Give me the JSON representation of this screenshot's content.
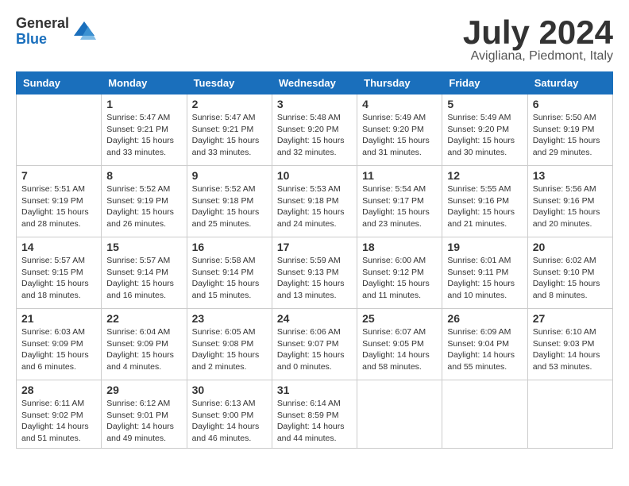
{
  "logo": {
    "general": "General",
    "blue": "Blue"
  },
  "title": "July 2024",
  "location": "Avigliana, Piedmont, Italy",
  "headers": [
    "Sunday",
    "Monday",
    "Tuesday",
    "Wednesday",
    "Thursday",
    "Friday",
    "Saturday"
  ],
  "weeks": [
    [
      {
        "day": "",
        "info": ""
      },
      {
        "day": "1",
        "info": "Sunrise: 5:47 AM\nSunset: 9:21 PM\nDaylight: 15 hours\nand 33 minutes."
      },
      {
        "day": "2",
        "info": "Sunrise: 5:47 AM\nSunset: 9:21 PM\nDaylight: 15 hours\nand 33 minutes."
      },
      {
        "day": "3",
        "info": "Sunrise: 5:48 AM\nSunset: 9:20 PM\nDaylight: 15 hours\nand 32 minutes."
      },
      {
        "day": "4",
        "info": "Sunrise: 5:49 AM\nSunset: 9:20 PM\nDaylight: 15 hours\nand 31 minutes."
      },
      {
        "day": "5",
        "info": "Sunrise: 5:49 AM\nSunset: 9:20 PM\nDaylight: 15 hours\nand 30 minutes."
      },
      {
        "day": "6",
        "info": "Sunrise: 5:50 AM\nSunset: 9:19 PM\nDaylight: 15 hours\nand 29 minutes."
      }
    ],
    [
      {
        "day": "7",
        "info": "Sunrise: 5:51 AM\nSunset: 9:19 PM\nDaylight: 15 hours\nand 28 minutes."
      },
      {
        "day": "8",
        "info": "Sunrise: 5:52 AM\nSunset: 9:19 PM\nDaylight: 15 hours\nand 26 minutes."
      },
      {
        "day": "9",
        "info": "Sunrise: 5:52 AM\nSunset: 9:18 PM\nDaylight: 15 hours\nand 25 minutes."
      },
      {
        "day": "10",
        "info": "Sunrise: 5:53 AM\nSunset: 9:18 PM\nDaylight: 15 hours\nand 24 minutes."
      },
      {
        "day": "11",
        "info": "Sunrise: 5:54 AM\nSunset: 9:17 PM\nDaylight: 15 hours\nand 23 minutes."
      },
      {
        "day": "12",
        "info": "Sunrise: 5:55 AM\nSunset: 9:16 PM\nDaylight: 15 hours\nand 21 minutes."
      },
      {
        "day": "13",
        "info": "Sunrise: 5:56 AM\nSunset: 9:16 PM\nDaylight: 15 hours\nand 20 minutes."
      }
    ],
    [
      {
        "day": "14",
        "info": "Sunrise: 5:57 AM\nSunset: 9:15 PM\nDaylight: 15 hours\nand 18 minutes."
      },
      {
        "day": "15",
        "info": "Sunrise: 5:57 AM\nSunset: 9:14 PM\nDaylight: 15 hours\nand 16 minutes."
      },
      {
        "day": "16",
        "info": "Sunrise: 5:58 AM\nSunset: 9:14 PM\nDaylight: 15 hours\nand 15 minutes."
      },
      {
        "day": "17",
        "info": "Sunrise: 5:59 AM\nSunset: 9:13 PM\nDaylight: 15 hours\nand 13 minutes."
      },
      {
        "day": "18",
        "info": "Sunrise: 6:00 AM\nSunset: 9:12 PM\nDaylight: 15 hours\nand 11 minutes."
      },
      {
        "day": "19",
        "info": "Sunrise: 6:01 AM\nSunset: 9:11 PM\nDaylight: 15 hours\nand 10 minutes."
      },
      {
        "day": "20",
        "info": "Sunrise: 6:02 AM\nSunset: 9:10 PM\nDaylight: 15 hours\nand 8 minutes."
      }
    ],
    [
      {
        "day": "21",
        "info": "Sunrise: 6:03 AM\nSunset: 9:09 PM\nDaylight: 15 hours\nand 6 minutes."
      },
      {
        "day": "22",
        "info": "Sunrise: 6:04 AM\nSunset: 9:09 PM\nDaylight: 15 hours\nand 4 minutes."
      },
      {
        "day": "23",
        "info": "Sunrise: 6:05 AM\nSunset: 9:08 PM\nDaylight: 15 hours\nand 2 minutes."
      },
      {
        "day": "24",
        "info": "Sunrise: 6:06 AM\nSunset: 9:07 PM\nDaylight: 15 hours\nand 0 minutes."
      },
      {
        "day": "25",
        "info": "Sunrise: 6:07 AM\nSunset: 9:05 PM\nDaylight: 14 hours\nand 58 minutes."
      },
      {
        "day": "26",
        "info": "Sunrise: 6:09 AM\nSunset: 9:04 PM\nDaylight: 14 hours\nand 55 minutes."
      },
      {
        "day": "27",
        "info": "Sunrise: 6:10 AM\nSunset: 9:03 PM\nDaylight: 14 hours\nand 53 minutes."
      }
    ],
    [
      {
        "day": "28",
        "info": "Sunrise: 6:11 AM\nSunset: 9:02 PM\nDaylight: 14 hours\nand 51 minutes."
      },
      {
        "day": "29",
        "info": "Sunrise: 6:12 AM\nSunset: 9:01 PM\nDaylight: 14 hours\nand 49 minutes."
      },
      {
        "day": "30",
        "info": "Sunrise: 6:13 AM\nSunset: 9:00 PM\nDaylight: 14 hours\nand 46 minutes."
      },
      {
        "day": "31",
        "info": "Sunrise: 6:14 AM\nSunset: 8:59 PM\nDaylight: 14 hours\nand 44 minutes."
      },
      {
        "day": "",
        "info": ""
      },
      {
        "day": "",
        "info": ""
      },
      {
        "day": "",
        "info": ""
      }
    ]
  ]
}
